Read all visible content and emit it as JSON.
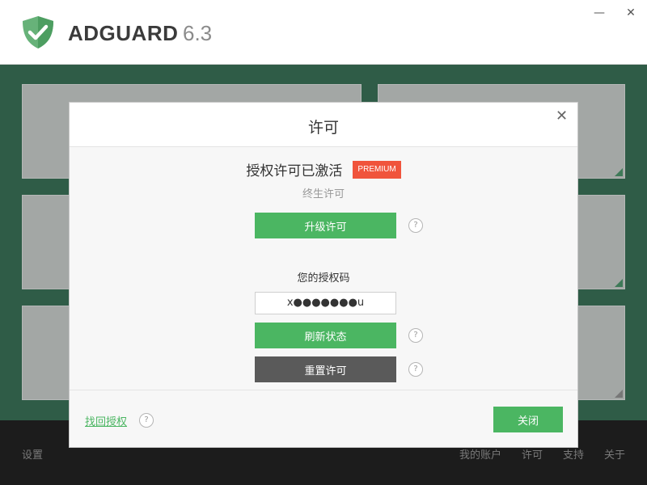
{
  "app": {
    "brand": "ADGUARD",
    "version": "6.3"
  },
  "window_controls": {
    "minimize": "—",
    "close": "✕"
  },
  "footer": {
    "settings": "设置",
    "my_account": "我的账户",
    "license": "许可",
    "support": "支持",
    "about": "关于"
  },
  "dialog": {
    "title": "许可",
    "close_glyph": "✕",
    "status_text": "授权许可已激活",
    "badge": "PREMIUM",
    "license_type": "终生许可",
    "upgrade_label": "升级许可",
    "key_label": "您的授权码",
    "key_value": "x●●●●●●●u",
    "refresh_label": "刷新状态",
    "reset_label": "重置许可",
    "recover_label": "找回授权",
    "close_label": "关闭",
    "help_glyph": "?"
  },
  "colors": {
    "accent": "#4bb662",
    "badge": "#f0543c",
    "background": "#2f5c47",
    "footer": "#1c1c1c",
    "dark_button": "#5a5a5a"
  },
  "icons": {
    "logo": "shield-check-icon",
    "help": "question-circle-icon"
  }
}
